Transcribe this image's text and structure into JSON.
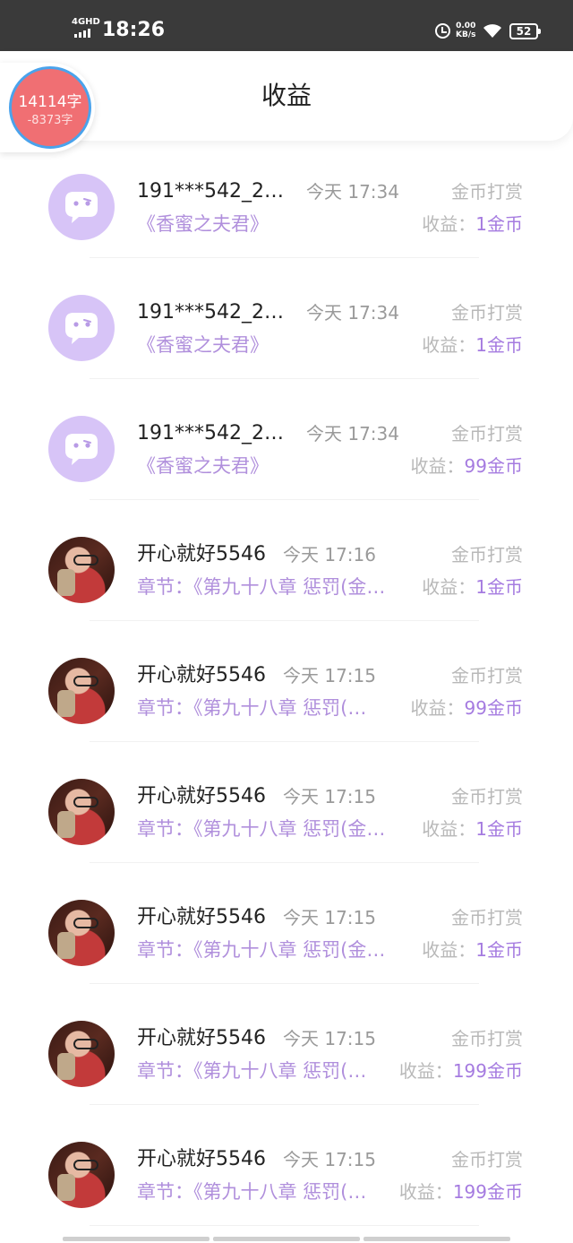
{
  "status_bar": {
    "network": "4GHD",
    "time": "18:26",
    "speed_value": "0.00",
    "speed_unit": "KB/s",
    "battery": "52"
  },
  "header": {
    "title": "收益"
  },
  "word_widget": {
    "main": "14114字",
    "sub": "-8373字"
  },
  "records": [
    {
      "avatar": "default",
      "name": "191***542_2…",
      "time": "今天 17:34",
      "type": "金币打赏",
      "sub": "《香蜜之夫君》",
      "earn_label": "收益：",
      "earn_value": "1金币"
    },
    {
      "avatar": "default",
      "name": "191***542_2…",
      "time": "今天 17:34",
      "type": "金币打赏",
      "sub": "《香蜜之夫君》",
      "earn_label": "收益：",
      "earn_value": "1金币"
    },
    {
      "avatar": "default",
      "name": "191***542_2…",
      "time": "今天 17:34",
      "type": "金币打赏",
      "sub": "《香蜜之夫君》",
      "earn_label": "收益：",
      "earn_value": "99金币"
    },
    {
      "avatar": "photo",
      "name": "开心就好5546",
      "time": "今天 17:16",
      "type": "金币打赏",
      "sub": "章节：《第九十八章 惩罚(金…",
      "earn_label": "收益：",
      "earn_value": "1金币"
    },
    {
      "avatar": "photo",
      "name": "开心就好5546",
      "time": "今天 17:15",
      "type": "金币打赏",
      "sub": "章节：《第九十八章 惩罚(…",
      "earn_label": "收益：",
      "earn_value": "99金币"
    },
    {
      "avatar": "photo",
      "name": "开心就好5546",
      "time": "今天 17:15",
      "type": "金币打赏",
      "sub": "章节：《第九十八章 惩罚(金…",
      "earn_label": "收益：",
      "earn_value": "1金币"
    },
    {
      "avatar": "photo",
      "name": "开心就好5546",
      "time": "今天 17:15",
      "type": "金币打赏",
      "sub": "章节：《第九十八章 惩罚(金…",
      "earn_label": "收益：",
      "earn_value": "1金币"
    },
    {
      "avatar": "photo",
      "name": "开心就好5546",
      "time": "今天 17:15",
      "type": "金币打赏",
      "sub": "章节：《第九十八章 惩罚(…",
      "earn_label": "收益：",
      "earn_value": "199金币"
    },
    {
      "avatar": "photo",
      "name": "开心就好5546",
      "time": "今天 17:15",
      "type": "金币打赏",
      "sub": "章节：《第九十八章 惩罚(…",
      "earn_label": "收益：",
      "earn_value": "199金币"
    }
  ]
}
